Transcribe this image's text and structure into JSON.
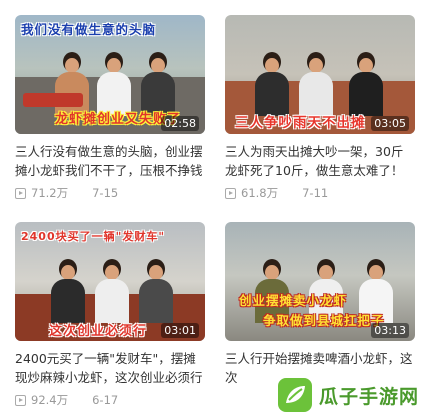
{
  "videos": [
    {
      "overlay_top": "我们没有做生意的头脑",
      "overlay_bottom": "龙虾摊创业又失败了",
      "duration": "02:58",
      "title": "三人行没有做生意的头脑，创业摆摊小龙虾我们不干了，压根不挣钱",
      "views": "71.2万",
      "date": "7-15"
    },
    {
      "overlay_top": "",
      "overlay_bottom": "三人争吵雨天不出摊",
      "duration": "03:05",
      "title": "三人为雨天出摊大吵一架，30斤龙虾死了10斤，做生意太难了！",
      "views": "61.8万",
      "date": "7-11"
    },
    {
      "overlay_top": "2400块买了一辆\"发财车\"",
      "overlay_bottom": "这次创业必须行",
      "duration": "03:01",
      "title": "2400元买了一辆\"发财车\"，摆摊现炒麻辣小龙虾，这次创业必须行",
      "views": "92.4万",
      "date": "6-17"
    },
    {
      "overlay_top": "",
      "overlay_bottom": "创业摆摊卖小龙虾",
      "overlay_bottom2": "争取做到县城扛把子",
      "duration": "03:13",
      "title": "三人行开始摆摊卖啤酒小龙虾，这次",
      "views": "",
      "date": ""
    }
  ],
  "watermark": {
    "text": "瓜子手游网",
    "color": "#4a9a2c"
  }
}
